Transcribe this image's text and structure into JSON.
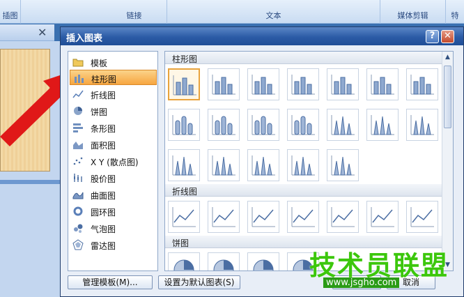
{
  "ribbon": {
    "groups": [
      {
        "label": "插图"
      },
      {
        "label": "链接"
      },
      {
        "label": "文本"
      },
      {
        "label": "媒体剪辑"
      },
      {
        "label": "特"
      }
    ]
  },
  "dialog": {
    "title": "插入图表",
    "help_label": "?",
    "close_label": "✕",
    "chart_types": [
      {
        "label": "模板",
        "icon": "folder-icon"
      },
      {
        "label": "柱形图",
        "icon": "column-chart-icon",
        "selected": true
      },
      {
        "label": "折线图",
        "icon": "line-chart-icon"
      },
      {
        "label": "饼图",
        "icon": "pie-chart-icon"
      },
      {
        "label": "条形图",
        "icon": "bar-chart-icon"
      },
      {
        "label": "面积图",
        "icon": "area-chart-icon"
      },
      {
        "label": "X Y (散点图)",
        "icon": "scatter-chart-icon"
      },
      {
        "label": "股价图",
        "icon": "stock-chart-icon"
      },
      {
        "label": "曲面图",
        "icon": "surface-chart-icon"
      },
      {
        "label": "圆环图",
        "icon": "doughnut-chart-icon"
      },
      {
        "label": "气泡图",
        "icon": "bubble-chart-icon"
      },
      {
        "label": "雷达图",
        "icon": "radar-chart-icon"
      }
    ],
    "sections": [
      {
        "label": "柱形图"
      },
      {
        "label": "折线图"
      },
      {
        "label": "饼图"
      }
    ],
    "manage_templates_label": "管理模板(M)...",
    "set_default_label": "设置为默认图表(S)",
    "ok_label": "确定",
    "cancel_label": "取消",
    "selection_color": "#f7a640"
  },
  "watermark": {
    "title": "技术员联盟",
    "url": "www.jsgho.com"
  }
}
